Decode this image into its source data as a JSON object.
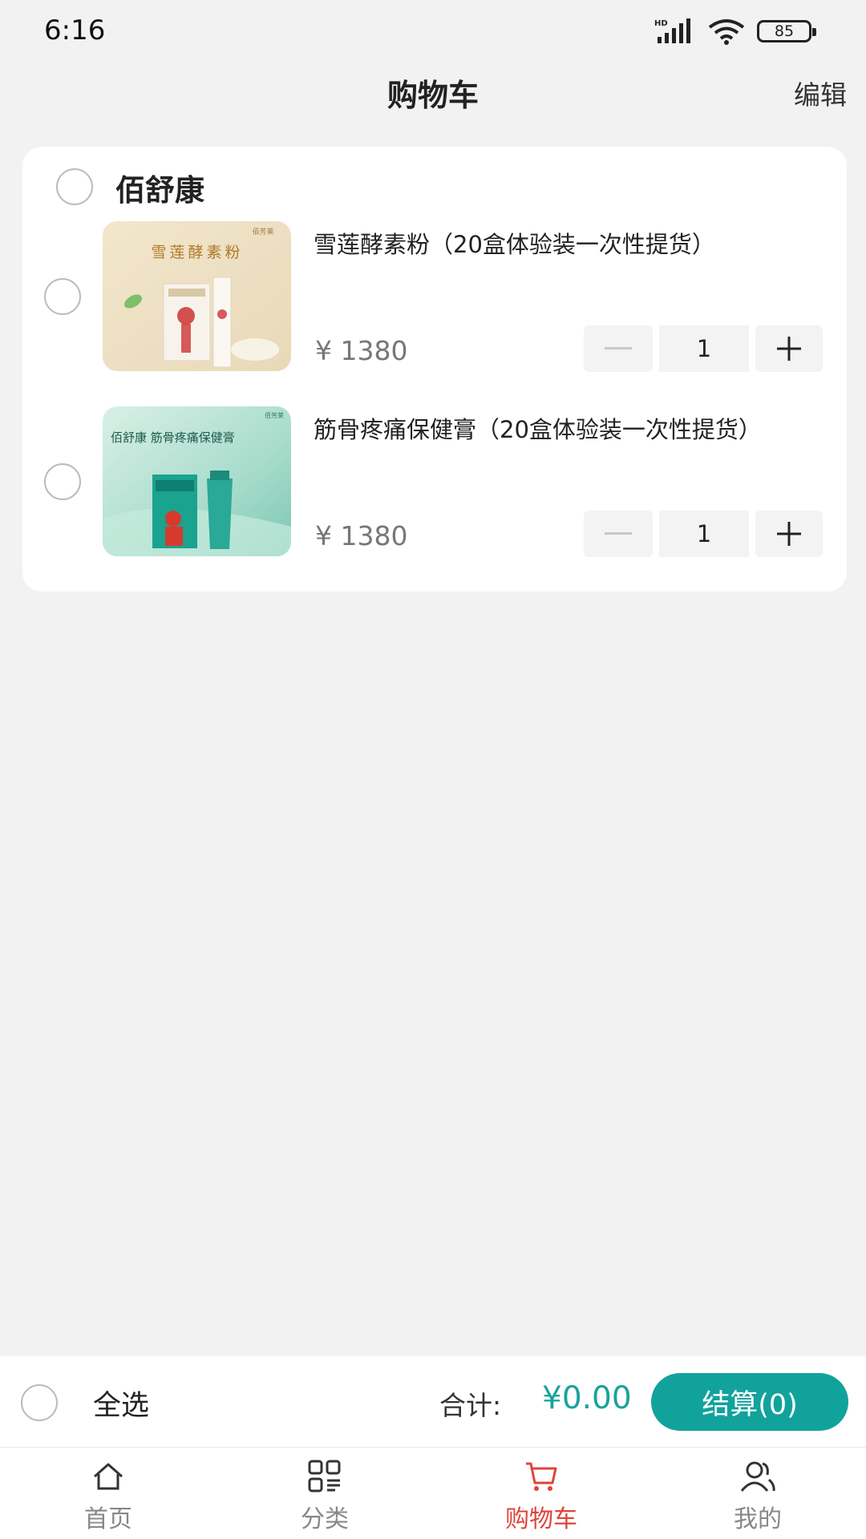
{
  "status_bar": {
    "time": "6:16",
    "battery": "85",
    "network_label": "HD"
  },
  "header": {
    "title": "购物车",
    "edit_label": "编辑"
  },
  "store": {
    "name": "佰舒康",
    "items": [
      {
        "title": "雪莲酵素粉（20盒体验装一次性提货）",
        "price": "¥ 1380",
        "quantity": "1",
        "image_text": "雪莲酵素粉",
        "brand_mark": "佰芳莱"
      },
      {
        "title": "筋骨疼痛保健膏（20盒体验装一次性提货）",
        "price": "¥ 1380",
        "quantity": "1",
        "image_text": "佰舒康 筋骨疼痛保健膏",
        "brand_mark": "佰芳莱"
      }
    ]
  },
  "summary": {
    "select_all_label": "全选",
    "total_label": "合计:",
    "total_amount": "¥0.00",
    "checkout_label": "结算(0)"
  },
  "tabs": [
    {
      "label": "首页",
      "icon": "home-icon"
    },
    {
      "label": "分类",
      "icon": "category-icon"
    },
    {
      "label": "购物车",
      "icon": "cart-icon",
      "active": true
    },
    {
      "label": "我的",
      "icon": "user-icon"
    }
  ],
  "colors": {
    "accent": "#12a29c",
    "active_tab": "#e0443c",
    "background": "#f2f2f2"
  }
}
